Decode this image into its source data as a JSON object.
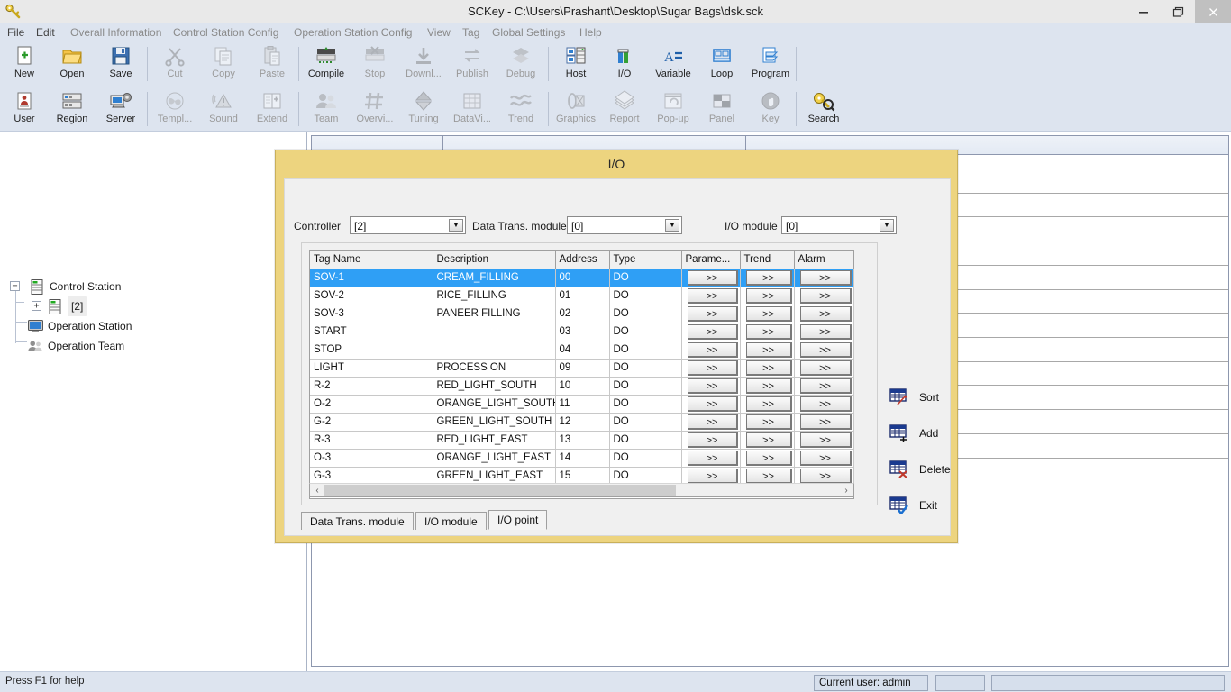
{
  "window": {
    "title": "SCKey - C:\\Users\\Prashant\\Desktop\\Sugar Bags\\dsk.sck",
    "app_icon": "key-icon",
    "minimize": "–",
    "maximize": "❐",
    "close": "✕"
  },
  "menu": [
    {
      "label": "File",
      "enabled": true
    },
    {
      "label": "Edit",
      "enabled": true
    },
    {
      "label": "Overall Information",
      "enabled": false
    },
    {
      "label": "Control Station Config",
      "enabled": false
    },
    {
      "label": "Operation Station Config",
      "enabled": false
    },
    {
      "label": "View",
      "enabled": false
    },
    {
      "label": "Tag",
      "enabled": false
    },
    {
      "label": "Global Settings",
      "enabled": false
    },
    {
      "label": "Help",
      "enabled": false
    }
  ],
  "toolbar": {
    "row1": [
      {
        "label": "New",
        "icon": "new-file-icon",
        "enabled": true
      },
      {
        "label": "Open",
        "icon": "open-folder-icon",
        "enabled": true
      },
      {
        "label": "Save",
        "icon": "save-disk-icon",
        "enabled": true
      },
      {
        "label": "Cut",
        "icon": "scissors-icon",
        "enabled": false
      },
      {
        "label": "Copy",
        "icon": "copy-icon",
        "enabled": false
      },
      {
        "label": "Paste",
        "icon": "clipboard-paste-icon",
        "enabled": false
      },
      {
        "label": "Compile",
        "icon": "compile-icon",
        "enabled": true
      },
      {
        "label": "Stop",
        "icon": "stop-icon",
        "enabled": false
      },
      {
        "label": "Downl...",
        "icon": "download-icon",
        "enabled": false
      },
      {
        "label": "Publish",
        "icon": "publish-arrows-icon",
        "enabled": false
      },
      {
        "label": "Debug",
        "icon": "debug-layers-icon",
        "enabled": false
      },
      {
        "label": "Host",
        "icon": "host-server-icon",
        "enabled": true
      },
      {
        "label": "I/O",
        "icon": "io-bars-icon",
        "enabled": true
      },
      {
        "label": "Variable",
        "icon": "variable-icon",
        "enabled": true
      },
      {
        "label": "Loop",
        "icon": "loop-icon",
        "enabled": true
      },
      {
        "label": "Program",
        "icon": "program-icon",
        "enabled": true
      }
    ],
    "row2": [
      {
        "label": "User",
        "icon": "user-icon",
        "enabled": true
      },
      {
        "label": "Region",
        "icon": "region-grid-icon",
        "enabled": true
      },
      {
        "label": "Server",
        "icon": "server-gear-icon",
        "enabled": true
      },
      {
        "label": "Templ...",
        "icon": "template-fan-icon",
        "enabled": false
      },
      {
        "label": "Sound",
        "icon": "sound-alert-icon",
        "enabled": false
      },
      {
        "label": "Extend",
        "icon": "extend-icon",
        "enabled": false
      },
      {
        "label": "Team",
        "icon": "team-people-icon",
        "enabled": false
      },
      {
        "label": "Overvi...",
        "icon": "overview-hash-icon",
        "enabled": false
      },
      {
        "label": "Tuning",
        "icon": "tuning-diamond-icon",
        "enabled": false
      },
      {
        "label": "DataVi...",
        "icon": "dataview-table-icon",
        "enabled": false
      },
      {
        "label": "Trend",
        "icon": "trend-wave-icon",
        "enabled": false
      },
      {
        "label": "Graphics",
        "icon": "graphics-icon",
        "enabled": false
      },
      {
        "label": "Report",
        "icon": "report-pages-icon",
        "enabled": false
      },
      {
        "label": "Pop-up",
        "icon": "popup-window-icon",
        "enabled": false
      },
      {
        "label": "Panel",
        "icon": "panel-checker-icon",
        "enabled": false
      },
      {
        "label": "Key",
        "icon": "key-hand-icon",
        "enabled": false
      },
      {
        "label": "Search",
        "icon": "search-key-icon",
        "enabled": true
      }
    ]
  },
  "tree": [
    {
      "label": "Control Station",
      "icon": "station-rack-icon",
      "expander": "−",
      "depth": 0,
      "selected": false
    },
    {
      "label": "[2]",
      "icon": "station-rack-icon",
      "expander": "+",
      "depth": 1,
      "selected": true
    },
    {
      "label": "Operation Station",
      "icon": "monitor-icon",
      "expander": "",
      "depth": 1,
      "selected": false
    },
    {
      "label": "Operation Team",
      "icon": "team-people-icon",
      "expander": "",
      "depth": 1,
      "selected": false
    }
  ],
  "dialog": {
    "title": "I/O",
    "fields": [
      {
        "label": "Controller",
        "value": "[2]"
      },
      {
        "label": "Data Trans. module",
        "value": "[0]"
      },
      {
        "label": "I/O module",
        "value": "[0]"
      }
    ],
    "table": {
      "columns": [
        "Tag Name",
        "Description",
        "Address",
        "Type",
        "Parame...",
        "Trend",
        "Alarm"
      ],
      "button_label": ">>",
      "rows": [
        {
          "tag": "SOV-1",
          "description": "CREAM_FILLING",
          "address": "00",
          "type": "DO",
          "selected": true
        },
        {
          "tag": "SOV-2",
          "description": "RICE_FILLING",
          "address": "01",
          "type": "DO",
          "selected": false
        },
        {
          "tag": "SOV-3",
          "description": "PANEER FILLING",
          "address": "02",
          "type": "DO",
          "selected": false
        },
        {
          "tag": "START",
          "description": "",
          "address": "03",
          "type": "DO",
          "selected": false
        },
        {
          "tag": "STOP",
          "description": "",
          "address": "04",
          "type": "DO",
          "selected": false
        },
        {
          "tag": "LIGHT",
          "description": "PROCESS ON",
          "address": "09",
          "type": "DO",
          "selected": false
        },
        {
          "tag": "R-2",
          "description": "RED_LIGHT_SOUTH",
          "address": "10",
          "type": "DO",
          "selected": false
        },
        {
          "tag": "O-2",
          "description": "ORANGE_LIGHT_SOUTH",
          "address": "11",
          "type": "DO",
          "selected": false
        },
        {
          "tag": "G-2",
          "description": "GREEN_LIGHT_SOUTH",
          "address": "12",
          "type": "DO",
          "selected": false
        },
        {
          "tag": "R-3",
          "description": "RED_LIGHT_EAST",
          "address": "13",
          "type": "DO",
          "selected": false
        },
        {
          "tag": "O-3",
          "description": "ORANGE_LIGHT_EAST",
          "address": "14",
          "type": "DO",
          "selected": false
        },
        {
          "tag": "G-3",
          "description": "GREEN_LIGHT_EAST",
          "address": "15",
          "type": "DO",
          "selected": false
        }
      ]
    },
    "scrollbar": {
      "left_arrow": "‹",
      "right_arrow": "›"
    },
    "actions": [
      {
        "label": "Sort",
        "icon": "sort-grid-icon"
      },
      {
        "label": "Add",
        "icon": "add-grid-icon"
      },
      {
        "label": "Delete",
        "icon": "delete-grid-icon"
      },
      {
        "label": "Exit",
        "icon": "exit-grid-icon"
      }
    ],
    "tabs": [
      {
        "label": "Data Trans. module",
        "active": false
      },
      {
        "label": "I/O module",
        "active": false
      },
      {
        "label": "I/O point",
        "active": true
      }
    ]
  },
  "statusbar": {
    "hint": "Press F1 for help",
    "panels": [
      {
        "text": "Current user: admin"
      },
      {
        "text": ""
      },
      {
        "text": ""
      }
    ]
  },
  "colors": {
    "dialog_accent": "#edd47f",
    "selection": "#2f9ff5",
    "chrome": "#dde4ef"
  }
}
